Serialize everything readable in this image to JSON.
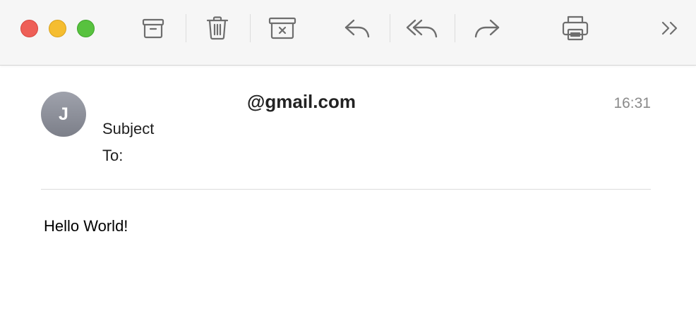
{
  "window": {
    "traffic_lights": [
      "close",
      "minimize",
      "zoom"
    ]
  },
  "toolbar": {
    "buttons": [
      {
        "name": "archive",
        "icon": "archive-icon"
      },
      {
        "name": "delete",
        "icon": "trash-icon"
      },
      {
        "name": "move-to-junk",
        "icon": "junk-icon"
      },
      {
        "name": "reply",
        "icon": "reply-icon"
      },
      {
        "name": "reply-all",
        "icon": "reply-all-icon"
      },
      {
        "name": "forward",
        "icon": "forward-icon"
      },
      {
        "name": "print",
        "icon": "printer-icon"
      },
      {
        "name": "more",
        "icon": "chevron-double-right-icon"
      }
    ],
    "icon_color": "#6e6e6e"
  },
  "message": {
    "avatar_initial": "J",
    "sender": "@gmail.com",
    "time": "16:31",
    "subject": "Subject",
    "to_label": "To:",
    "body": "Hello World!"
  }
}
